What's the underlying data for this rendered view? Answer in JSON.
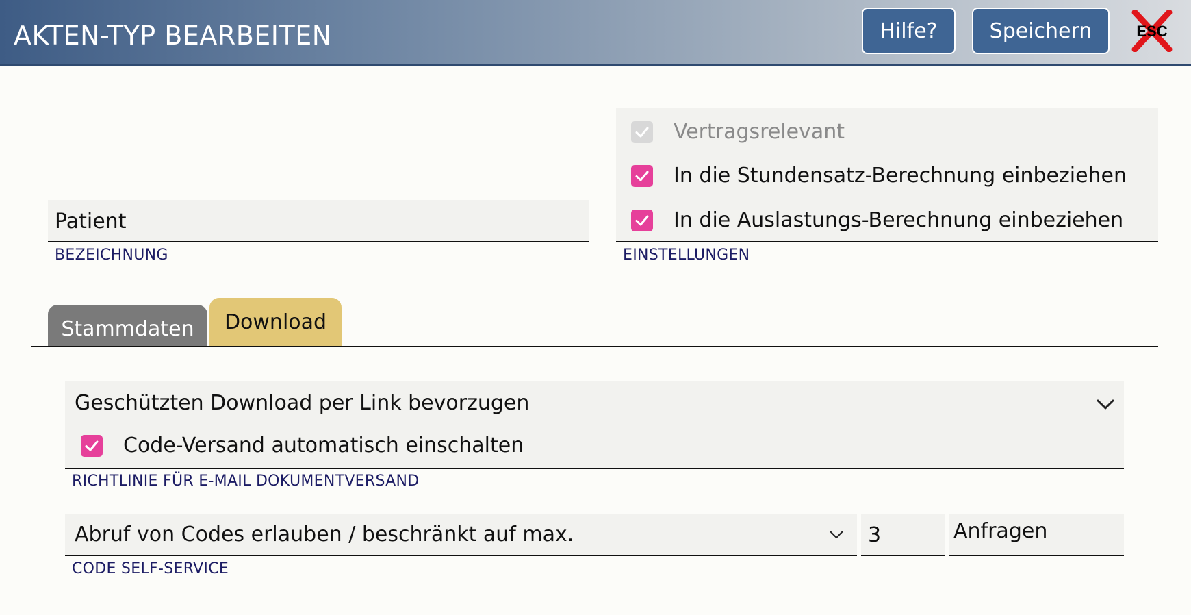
{
  "header": {
    "title": "AKTEN-TYP BEARBEITEN",
    "help_label": "Hilfe?",
    "save_label": "Speichern",
    "close_label": "ESC"
  },
  "bezeichnung": {
    "value": "Patient",
    "caption": "BEZEICHNUNG"
  },
  "einstellungen": {
    "caption": "EINSTELLUNGEN",
    "options": [
      {
        "label": "Vertragsrelevant",
        "checked": true,
        "disabled": true
      },
      {
        "label": "In die Stundensatz-Berechnung einbeziehen",
        "checked": true,
        "disabled": false
      },
      {
        "label": "In die Auslastungs-Berechnung einbeziehen",
        "checked": true,
        "disabled": false
      }
    ]
  },
  "tabs": [
    {
      "label": "Stammdaten",
      "active": false
    },
    {
      "label": "Download",
      "active": true
    }
  ],
  "email_policy": {
    "selected": "Geschützten Download per Link bevorzugen",
    "checkbox_label": "Code-Versand automatisch einschalten",
    "checkbox_checked": true,
    "caption": "RICHTLINIE FÜR E-MAIL DOKUMENTVERSAND"
  },
  "code_self_service": {
    "selected": "Abruf von Codes erlauben / beschränkt auf max.",
    "max_value": "3",
    "unit": "Anfragen",
    "caption": "CODE SELF-SERVICE"
  },
  "colors": {
    "accent_checkbox": "#e6409a",
    "button": "#3f6594",
    "tab_active": "#e2c776",
    "tab_inactive": "#7a7a7a",
    "caption": "#1c1c64"
  }
}
